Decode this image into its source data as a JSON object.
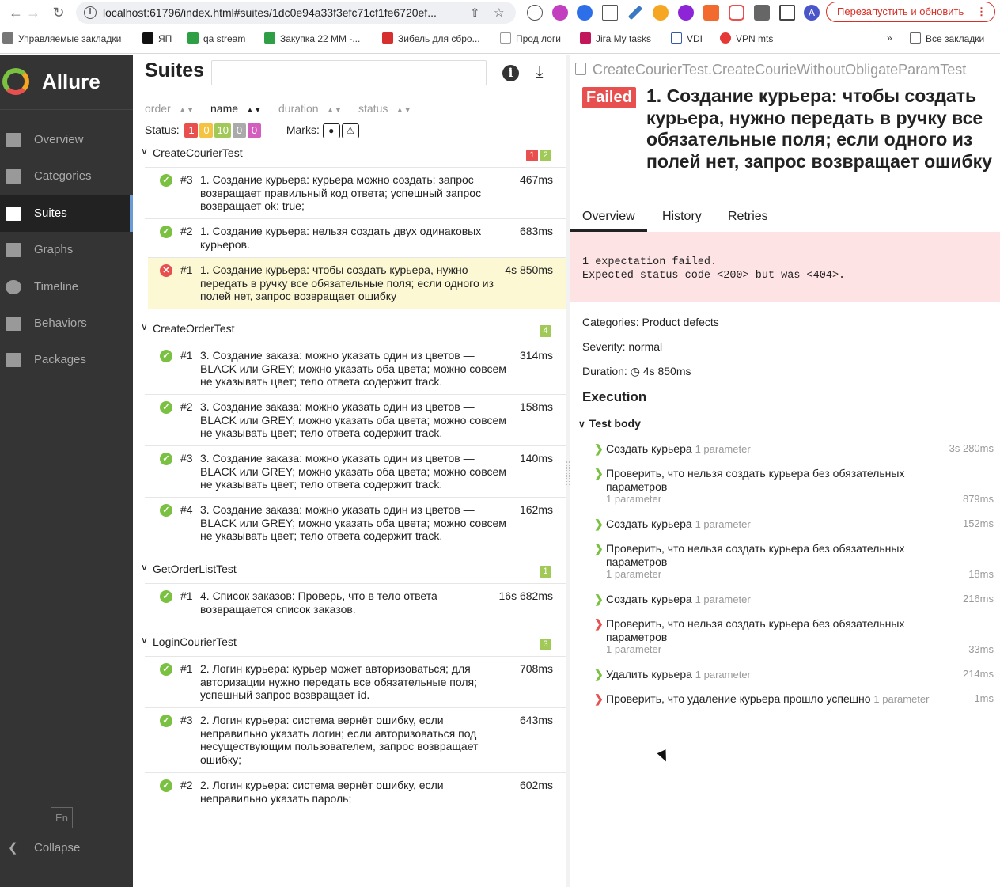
{
  "browser": {
    "url": "localhost:61796/index.html#suites/1dc0e94a33f3efc71cf1fe6720ef...",
    "relaunch_label": "Перезапустить и обновить",
    "profile_initial": "A",
    "bookmarks": [
      "Управляемые закладки",
      "ЯП",
      "qa stream",
      "Закупка 22 ММ -...",
      "Зибель для сбро...",
      "Прод логи",
      "Jira My tasks",
      "VDI",
      "VPN mts"
    ],
    "more_label": "»",
    "all_bookmarks_label": "Все закладки"
  },
  "sidebar": {
    "brand": "Allure",
    "items": [
      {
        "label": "Overview",
        "icon": "home-icon"
      },
      {
        "label": "Categories",
        "icon": "flag-icon"
      },
      {
        "label": "Suites",
        "icon": "briefcase-icon",
        "active": true
      },
      {
        "label": "Graphs",
        "icon": "bar-chart-icon"
      },
      {
        "label": "Timeline",
        "icon": "clock-icon"
      },
      {
        "label": "Behaviors",
        "icon": "list-icon"
      },
      {
        "label": "Packages",
        "icon": "align-left-icon"
      }
    ],
    "lang": "En",
    "collapse_label": "Collapse"
  },
  "suites": {
    "title": "Suites",
    "sort": [
      "order",
      "name",
      "duration",
      "status"
    ],
    "status_label": "Status:",
    "status_counts": [
      {
        "value": "1",
        "color": "#e84f4f"
      },
      {
        "value": "0",
        "color": "#f5c342"
      },
      {
        "value": "10",
        "color": "#a1c957"
      },
      {
        "value": "0",
        "color": "#aaaaaa"
      },
      {
        "value": "0",
        "color": "#d35ebe"
      }
    ],
    "marks_label": "Marks:",
    "groups": [
      {
        "name": "CreateCourierTest",
        "badges": [
          {
            "value": "1",
            "color": "#e84f4f"
          },
          {
            "value": "2",
            "color": "#a1c957"
          }
        ]
      },
      {
        "name": "CreateOrderTest",
        "badges": [
          {
            "value": "4",
            "color": "#a1c957"
          }
        ]
      },
      {
        "name": "GetOrderListTest",
        "badges": [
          {
            "value": "1",
            "color": "#a1c957"
          }
        ]
      },
      {
        "name": "LoginCourierTest",
        "badges": [
          {
            "value": "3",
            "color": "#a1c957"
          }
        ]
      }
    ],
    "tests": [
      {
        "num": "#3",
        "name": "1. Создание курьера: курьера можно создать; запрос возвращает правильный код ответа; успешный запрос возвращает ok: true;",
        "duration": "467ms",
        "status": "passed"
      },
      {
        "num": "#2",
        "name": "1. Создание курьера: нельзя создать двух одинаковых курьеров.",
        "duration": "683ms",
        "status": "passed"
      },
      {
        "num": "#1",
        "name": "1. Создание курьера: чтобы создать курьера, нужно передать в ручку все обязательные поля; если одного из полей нет, запрос возвращает ошибку",
        "duration": "4s 850ms",
        "status": "failed"
      },
      {
        "num": "#1",
        "name": "3. Создание заказа: можно указать один из цветов — BLACK или GREY; можно указать оба цвета; можно совсем не указывать цвет; тело ответа содержит track.",
        "duration": "314ms",
        "status": "passed"
      },
      {
        "num": "#2",
        "name": "3. Создание заказа: можно указать один из цветов — BLACK или GREY; можно указать оба цвета; можно совсем не указывать цвет; тело ответа содержит track.",
        "duration": "158ms",
        "status": "passed"
      },
      {
        "num": "#3",
        "name": "3. Создание заказа: можно указать один из цветов — BLACK или GREY; можно указать оба цвета; можно совсем не указывать цвет; тело ответа содержит track.",
        "duration": "140ms",
        "status": "passed"
      },
      {
        "num": "#4",
        "name": "3. Создание заказа: можно указать один из цветов — BLACK или GREY; можно указать оба цвета; можно совсем не указывать цвет; тело ответа содержит track.",
        "duration": "162ms",
        "status": "passed"
      },
      {
        "num": "#1",
        "name": "4. Список заказов: Проверь, что в тело ответа возвращается список заказов.",
        "duration": "16s 682ms",
        "status": "passed"
      },
      {
        "num": "#1",
        "name": "2. Логин курьера: курьер может авторизоваться; для авторизации нужно передать все обязательные поля; успешный запрос возвращает id.",
        "duration": "708ms",
        "status": "passed"
      },
      {
        "num": "#3",
        "name": "2. Логин курьера: система вернёт ошибку, если неправильно указать логин; если авторизоваться под несуществующим пользователем, запрос возвращает ошибку;",
        "duration": "643ms",
        "status": "passed"
      },
      {
        "num": "#2",
        "name": "2. Логин курьера: система вернёт ошибку, если неправильно указать пароль;",
        "duration": "602ms",
        "status": "passed"
      }
    ]
  },
  "detail": {
    "path": "CreateCourierTest.CreateCourieWithoutObligateParamTest",
    "status": "Failed",
    "title": "1. Создание курьера: чтобы создать курьера, нужно передать в ручку все обязательные поля; если одного из полей нет, запрос возвращает ошибку",
    "tabs": [
      "Overview",
      "History",
      "Retries"
    ],
    "error": "1 expectation failed.\nExpected status code <200> but was <404>.",
    "categories": "Categories: Product defects",
    "severity": "Severity: normal",
    "duration_label": "Duration:",
    "duration_value": "4s 850ms",
    "execution_title": "Execution",
    "test_body_label": "Test body",
    "steps": [
      {
        "name": "Создать курьера",
        "param": "1 parameter",
        "duration": "3s 280ms",
        "status": "passed"
      },
      {
        "name": "Проверить, что нельзя создать курьера без обязательных параметров",
        "param": "1 parameter",
        "duration": "879ms",
        "status": "passed"
      },
      {
        "name": "Создать курьера",
        "param": "1 parameter",
        "duration": "152ms",
        "status": "passed"
      },
      {
        "name": "Проверить, что нельзя создать курьера без обязательных параметров",
        "param": "1 parameter",
        "duration": "18ms",
        "status": "passed"
      },
      {
        "name": "Создать курьера",
        "param": "1 parameter",
        "duration": "216ms",
        "status": "passed"
      },
      {
        "name": "Проверить, что нельзя создать курьера без обязательных параметров",
        "param": "1 parameter",
        "duration": "33ms",
        "status": "failed"
      },
      {
        "name": "Удалить курьера",
        "param": "1 parameter",
        "duration": "214ms",
        "status": "passed"
      },
      {
        "name": "Проверить, что удаление курьера прошло успешно",
        "param": "1 parameter",
        "duration": "1ms",
        "status": "failed"
      }
    ]
  }
}
